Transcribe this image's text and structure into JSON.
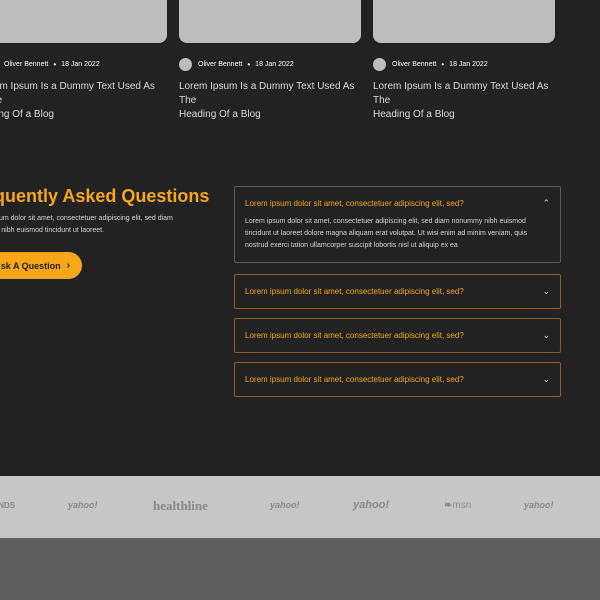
{
  "blog": {
    "posts": [
      {
        "author": "Oliver Bennett",
        "date": "18 Jan 2022",
        "title": "orem Ipsum Is a Dummy Text Used As The\nading Of a Blog"
      },
      {
        "author": "Oliver Bennett",
        "date": "18 Jan 2022",
        "title": "Lorem Ipsum Is a Dummy Text Used As The\nHeading Of a Blog"
      },
      {
        "author": "Oliver Bennett",
        "date": "18 Jan 2022",
        "title": "Lorem Ipsum Is a Dummy Text Used As The\nHeading Of a Blog"
      }
    ],
    "separator": "•"
  },
  "faq": {
    "heading": "equently Asked Questions",
    "intro": "ipsum dolor sit amet, consectetuer adipiscing elit, sed diam\nmy nibh euismod tincidunt ut laoreet.",
    "ask_button_label": "sk A Question",
    "items": [
      {
        "question": "Lorem ipsum dolor sit amet, consectetuer adipiscing elit, sed?",
        "answer": "Lorem ipsum dolor sit amet, consectetuer adipiscing elit, sed diam nonummy nibh euismod tincidunt ut laoreet dolore magna aliquam erat volutpat. Ut wisi enim ad minim veniam, quis nostrud exerci tation ullamcorper suscipit lobortis nisl ut aliquip ex ea",
        "expanded": true
      },
      {
        "question": "Lorem ipsum dolor sit amet, consectetuer adipiscing elit, sed?",
        "expanded": false
      },
      {
        "question": "Lorem ipsum dolor sit amet, consectetuer adipiscing elit, sed?",
        "expanded": false
      },
      {
        "question": "Lorem ipsum dolor sit amet, consectetuer adipiscing elit, sed?",
        "expanded": false
      }
    ]
  },
  "logos": [
    "INDS",
    "yahoo!",
    "healthline",
    "yahoo!",
    "yahoo!",
    "msn",
    "yahoo!"
  ],
  "colors": {
    "accent": "#f7a619",
    "background": "#222222",
    "logo_strip": "#c6c6c6",
    "footer": "#5e5e5e"
  }
}
